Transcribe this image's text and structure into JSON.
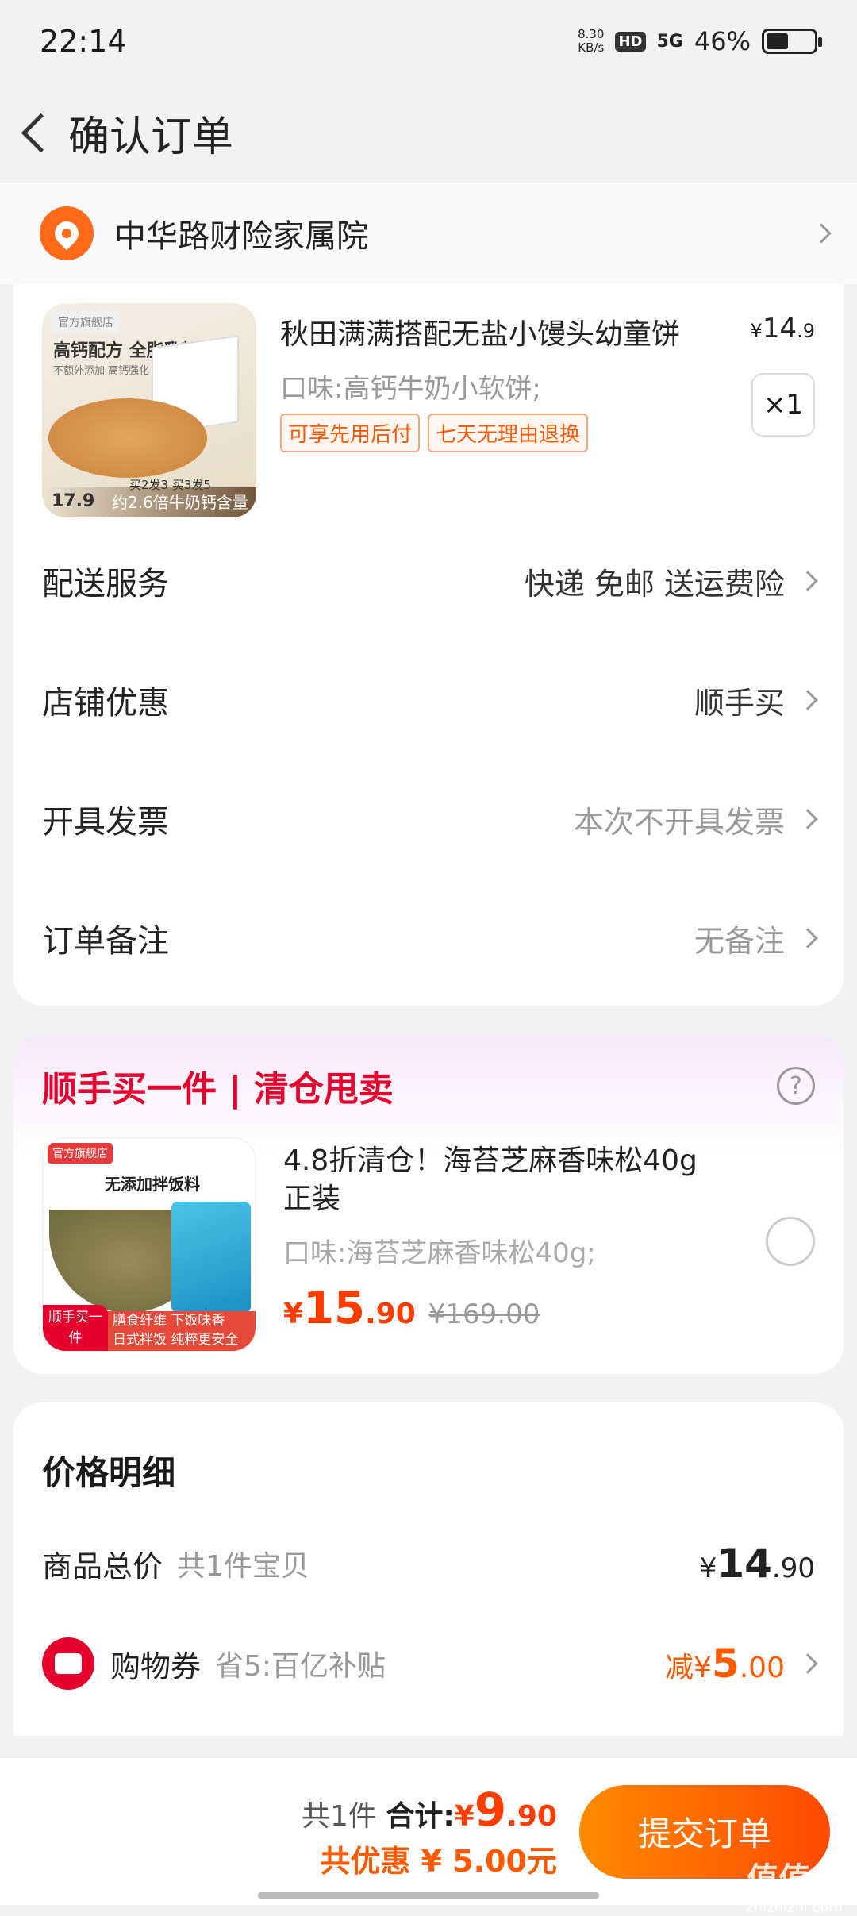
{
  "status": {
    "time": "22:14",
    "net_speed_top": "8.30",
    "net_speed_bottom": "KB/s",
    "hd": "HD",
    "network": "5G",
    "battery": "46%",
    "battery_level": 0.46
  },
  "nav": {
    "title": "确认订单"
  },
  "address": {
    "text": "中华路财险家属院"
  },
  "product": {
    "title": "秋田满满搭配无盐小馒头幼童饼",
    "price_symbol": "¥",
    "price_int": "14",
    "price_dec": ".9",
    "spec": "口味:高钙牛奶小软饼;",
    "badges": [
      "可享先用后付",
      "七天无理由退换"
    ],
    "qty": "×1",
    "thumb": {
      "tag": "官方旗舰店",
      "headline": "高钙配方 全脂乳粉",
      "sub": "不额外添加  高钙强化",
      "promo": "买2发3 买3发5",
      "strip": "约2.6倍牛奶钙含量",
      "price": "17.9"
    }
  },
  "rows": [
    {
      "label": "配送服务",
      "value": "快递 免邮 送运费险",
      "tone": "dark"
    },
    {
      "label": "店铺优惠",
      "value": "顺手买",
      "tone": "dark"
    },
    {
      "label": "开具发票",
      "value": "本次不开具发票",
      "tone": "grey"
    },
    {
      "label": "订单备注",
      "value": "无备注",
      "tone": "grey"
    }
  ],
  "addon": {
    "title": "顺手买一件 | 清仓甩卖",
    "help": "?",
    "product_title": "4.8折清仓！海苔芝麻香味松40g正装",
    "spec": "口味:海苔芝麻香味松40g;",
    "price_symbol": "¥",
    "price_int": "15",
    "price_dec": ".90",
    "orig_price": "¥169.00",
    "thumb": {
      "shop": "官方旗舰店",
      "headline": "无添加拌饭料",
      "badge": "顺手买一件",
      "bar_line1": "膳食纤维 下饭味香",
      "bar_line2": "日式拌饭 纯粹更安全"
    }
  },
  "price_detail": {
    "title": "价格明细",
    "goods_label": "商品总价",
    "goods_sub": "共1件宝贝",
    "goods_symbol": "¥",
    "goods_int": "14",
    "goods_dec": ".90",
    "coupon_label": "购物券",
    "coupon_sub": "省5:百亿补贴",
    "coupon_prefix": "减",
    "coupon_symbol": "¥",
    "coupon_int": "5",
    "coupon_dec": ".00"
  },
  "footer": {
    "count": "共1件",
    "total_label": "合计:",
    "total_symbol": "¥",
    "total_int": "9",
    "total_dec": ".90",
    "saving": "共优惠 ¥ 5.00元",
    "submit": "提交订单"
  },
  "watermark": {
    "main": "值值值",
    "sub": "zhizhizhi.com"
  }
}
